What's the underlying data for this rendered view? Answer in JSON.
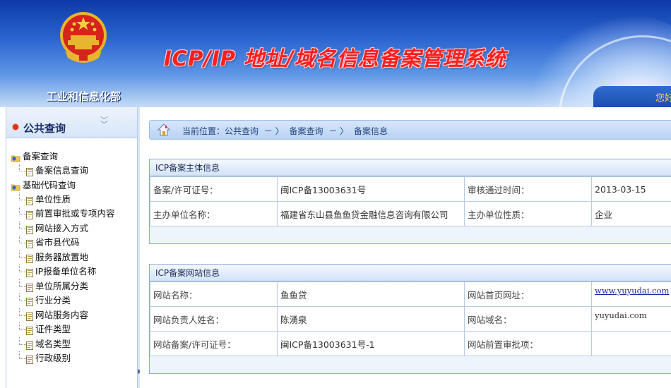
{
  "header": {
    "ministry": "工业和信息化部",
    "system_title": "ICP/IP 地址/域名信息备案管理系统",
    "greeting": "您好"
  },
  "sidebar": {
    "title": "公共查询",
    "groups": [
      {
        "label": "备案查询",
        "items": [
          "备案信息查询"
        ]
      },
      {
        "label": "基础代码查询",
        "items": [
          "单位性质",
          "前置审批或专项内容",
          "网站接入方式",
          "省市县代码",
          "服务器放置地",
          "IP报备单位名称",
          "单位所属分类",
          "行业分类",
          "网站服务内容",
          "证件类型",
          "域名类型",
          "行政级别"
        ]
      }
    ]
  },
  "breadcrumb": {
    "prefix": "当前位置：",
    "items": [
      "公共查询",
      "备案查询",
      "备案信息"
    ],
    "separator": "－ 〉"
  },
  "subject_panel": {
    "title": "ICP备案主体信息",
    "rows": [
      [
        "备案/许可证号：",
        "闽ICP备13003631号",
        "审核通过时间：",
        "2013-03-15"
      ],
      [
        "主办单位名称：",
        "福建省东山县鱼鱼贷金融信息咨询有限公司",
        "主办单位性质：",
        "企业"
      ]
    ]
  },
  "website_panel": {
    "title": "ICP备案网站信息",
    "rows": [
      [
        "网站名称：",
        "鱼鱼贷",
        "网站首页网址：",
        "www.yuyudai.com"
      ],
      [
        "网站负责人姓名：",
        "陈湧泉",
        "网站域名：",
        "yuyudai.com"
      ],
      [
        "网站备案/许可证号：",
        "闽ICP备13003631号-1",
        "网站前置审批项：",
        ""
      ]
    ]
  },
  "colors": {
    "header_top": "#0d3aa8",
    "title_red": "#ff1f1f",
    "panel_border": "#8eacd8",
    "link": "#1a2aa8"
  }
}
